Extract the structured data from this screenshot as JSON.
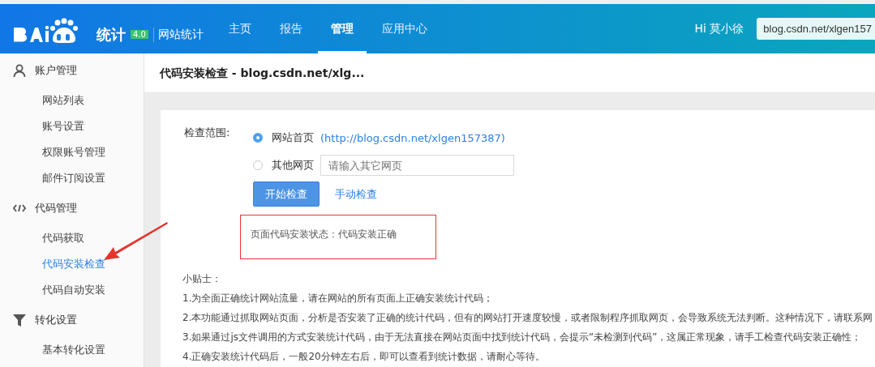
{
  "header": {
    "logo_text": "统计",
    "version": "4.0",
    "product": "网站统计",
    "nav": [
      {
        "label": "主页",
        "selected": false
      },
      {
        "label": "报告",
        "selected": false
      },
      {
        "label": "管理",
        "selected": true
      },
      {
        "label": "应用中心",
        "selected": false
      }
    ],
    "greeting": "Hi 莫小徐",
    "site_select": "blog.csdn.net/xlgen157"
  },
  "sidebar": {
    "groups": [
      {
        "title": "账户管理",
        "items": [
          {
            "label": "网站列表",
            "selected": false
          },
          {
            "label": "账号设置",
            "selected": false
          },
          {
            "label": "权限账号管理",
            "selected": false
          },
          {
            "label": "邮件订阅设置",
            "selected": false
          }
        ]
      },
      {
        "title": "代码管理",
        "items": [
          {
            "label": "代码获取",
            "selected": false
          },
          {
            "label": "代码安装检查",
            "selected": true
          },
          {
            "label": "代码自动安装",
            "selected": false
          }
        ]
      },
      {
        "title": "转化设置",
        "items": [
          {
            "label": "基本转化设置",
            "selected": false
          }
        ]
      }
    ]
  },
  "page_title": "代码安装检查 - blog.csdn.net/xlg...",
  "check": {
    "label": "检查范围:",
    "options": [
      {
        "label": "网站首页",
        "link": "(http://blog.csdn.net/xlgen157387)",
        "selected": true
      },
      {
        "label": "其他网页",
        "placeholder": "请输入其它网页",
        "selected": false
      }
    ],
    "start_button": "开始检查",
    "manual_link": "手动检查",
    "result": "页面代码安装状态：代码安装正确"
  },
  "tips": {
    "title": "小贴士：",
    "lines": [
      "1.为全面正确统计网站流量，请在网站的所有页面上正确安装统计代码；",
      "2.本功能通过抓取网站页面，分析是否安装了正确的统计代码，但有的网站打开速度较慢，或者限制程序抓取网页，会导致系统无法判断。这种情况下，请联系网",
      "3.如果通过js文件调用的方式安装统计代码，由于无法直接在网站页面中找到统计代码，会提示“未检测到代码”，这属正常现象，请手工检查代码安装正确性；",
      "4.正确安装统计代码后，一般20分钟左右后，即可以查看到统计数据，请耐心等待。"
    ]
  }
}
